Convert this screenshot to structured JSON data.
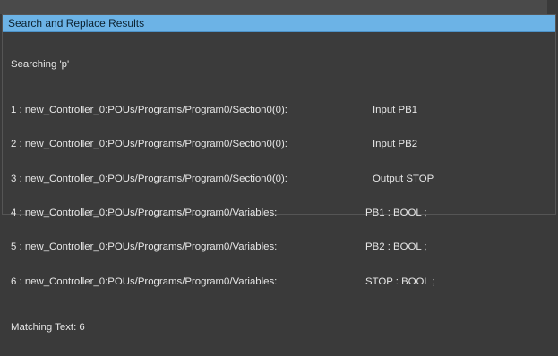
{
  "panel": {
    "title": "Search and Replace Results"
  },
  "results": {
    "header": "Searching 'p'",
    "rows": [
      {
        "path": "1 : new_Controller_0:POUs/Programs/Program0/Section0(0):",
        "detail": "Input PB1"
      },
      {
        "path": "2 : new_Controller_0:POUs/Programs/Program0/Section0(0):",
        "detail": "Input PB2"
      },
      {
        "path": "3 : new_Controller_0:POUs/Programs/Program0/Section0(0):",
        "detail": "Output STOP"
      },
      {
        "path": "4 : new_Controller_0:POUs/Programs/Program0/Variables:",
        "detail": "PB1 : BOOL ;"
      },
      {
        "path": "5 : new_Controller_0:POUs/Programs/Program0/Variables:",
        "detail": "PB2 : BOOL ;"
      },
      {
        "path": "6 : new_Controller_0:POUs/Programs/Program0/Variables:",
        "detail": "STOP : BOOL ;"
      }
    ],
    "footer": "Matching Text: 6"
  },
  "colors": {
    "title_bar": "#6cb3e6",
    "background": "#3b3b3b",
    "text": "#e6e6e6"
  }
}
